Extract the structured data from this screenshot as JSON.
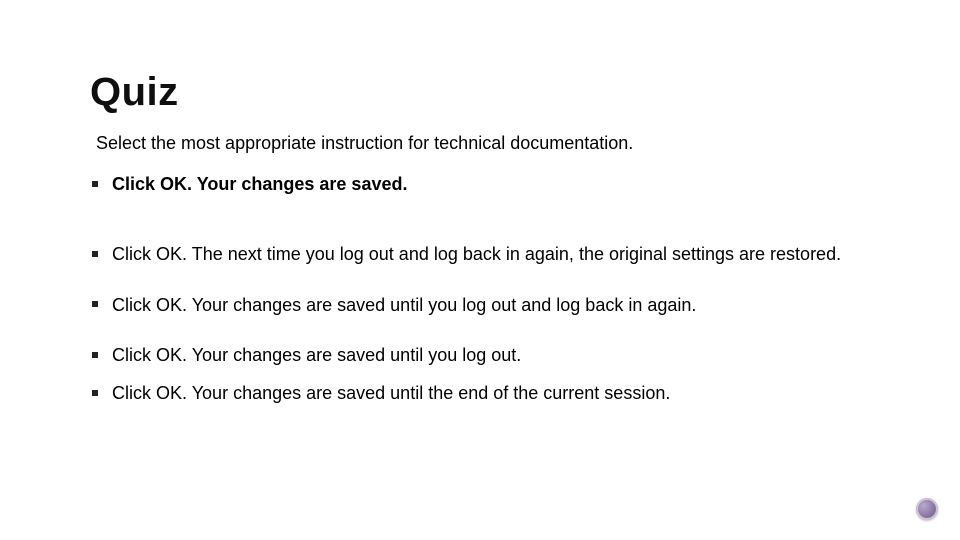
{
  "title": "Quiz",
  "prompt": "Select the most appropriate instruction for technical documentation.",
  "options": [
    {
      "prefix": "Click OK",
      "text": ". Your changes are saved.",
      "selected": true
    },
    {
      "prefix": "Click OK",
      "text": ". The next time you log out and log back in again, the original settings are restored.",
      "selected": false
    },
    {
      "prefix": "Click OK",
      "text": ". Your changes are saved until you log out and log back in again.",
      "selected": false
    },
    {
      "prefix": "Click OK",
      "text": ". Your changes are saved until you log out.",
      "selected": false
    },
    {
      "prefix": "Click OK",
      "text": ". Your changes are saved until the end of the current session.",
      "selected": false
    }
  ],
  "decoration": {
    "corner_icon": "sphere-icon",
    "color": "#8a749f"
  }
}
